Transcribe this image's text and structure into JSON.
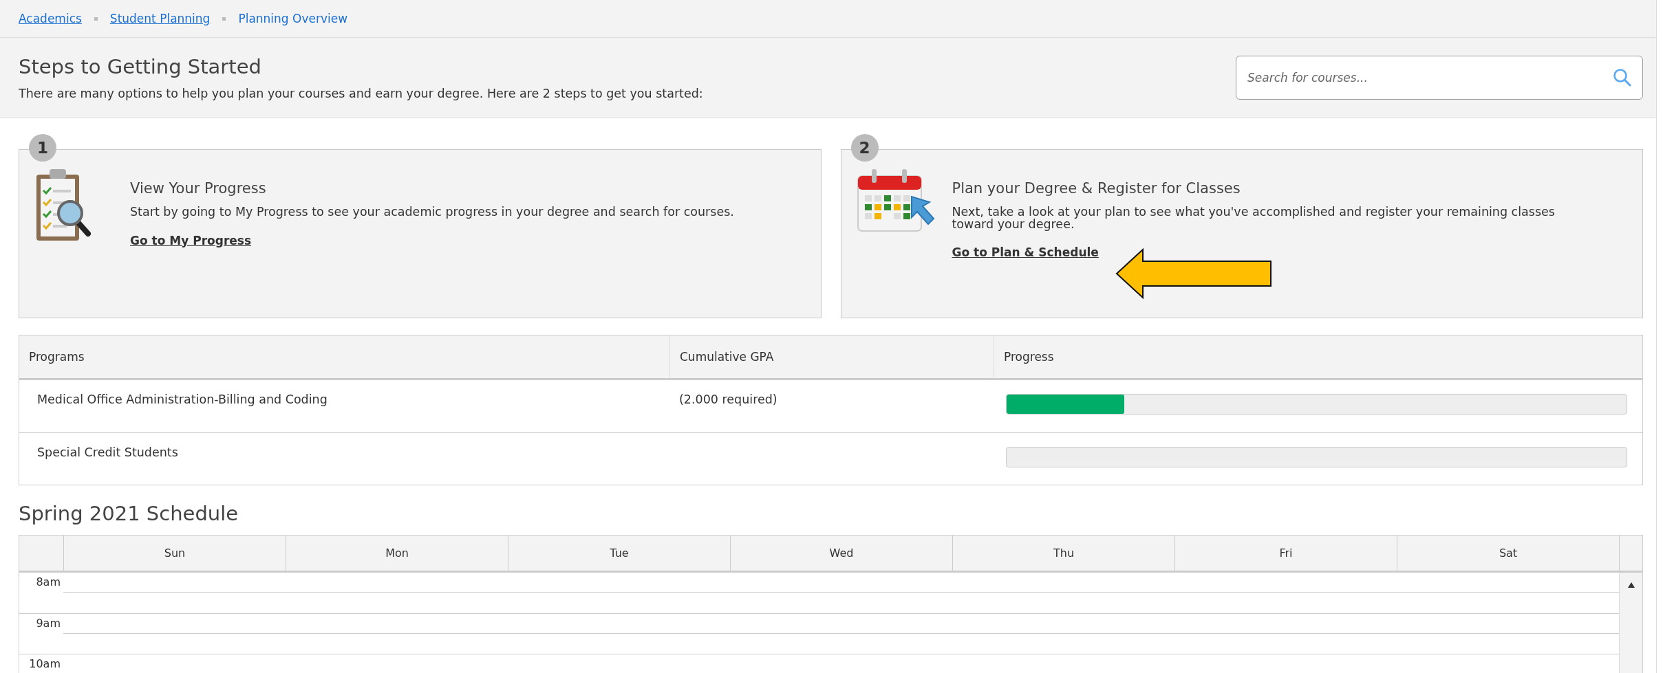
{
  "breadcrumbs": [
    {
      "label": "Academics",
      "link": true
    },
    {
      "label": "Student Planning",
      "link": true
    },
    {
      "label": "Planning Overview",
      "link": false
    }
  ],
  "header": {
    "title": "Steps to Getting Started",
    "subtitle": "There are many options to help you plan your courses and earn your degree. Here are 2 steps to get you started:",
    "search": {
      "placeholder": "Search for courses..."
    }
  },
  "steps": [
    {
      "number": "1",
      "kind": "progress",
      "title": "View Your Progress",
      "text": "Start by going to My Progress to see your academic progress in your degree and search for courses.",
      "link": "Go to My Progress",
      "highlighted": false
    },
    {
      "number": "2",
      "kind": "plan",
      "title": "Plan your Degree & Register for Classes",
      "text": "Next, take a look at your plan to see what you've accomplished and register your remaining classes toward your degree.",
      "link": "Go to Plan & Schedule",
      "highlighted": true
    }
  ],
  "programs": {
    "columns": [
      "Programs",
      "Cumulative GPA",
      "Progress"
    ],
    "rows": [
      {
        "program": "Medical Office Administration-Billing and Coding",
        "gpa": "(2.000 required)",
        "level": 0.19
      },
      {
        "program": "Special Credit Students"
      }
    ]
  },
  "schedule": {
    "title": "Spring 2021 Schedule",
    "days": [
      "Sun",
      "Mon",
      "Tue",
      "Wed",
      "Thu",
      "Fri",
      "Sat"
    ],
    "hours": [
      "8am",
      "9am",
      "10am"
    ]
  }
}
